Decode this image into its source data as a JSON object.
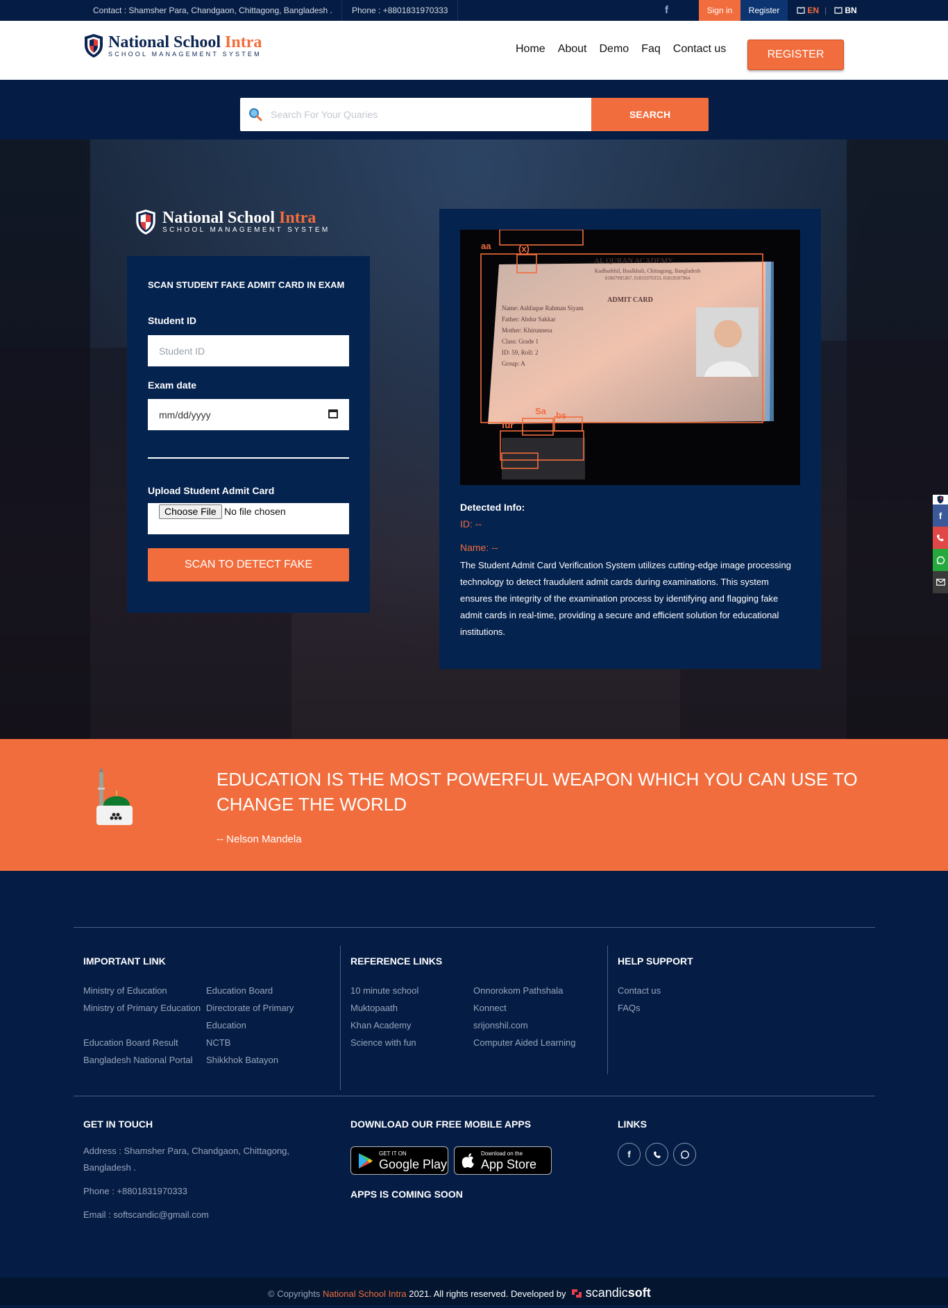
{
  "topbar": {
    "contact": "Contact : Shamsher Para, Chandgaon, Chittagong, Bangladesh .",
    "phone": "Phone : +8801831970333",
    "facebook_icon": "f",
    "signin": "Sign in",
    "register": "Register",
    "lang_en": "EN",
    "lang_separator": "|",
    "lang_bn": "BN"
  },
  "brand": {
    "name_primary": "National School",
    "name_accent": "Intra",
    "subtitle": "SCHOOL MANAGEMENT SYSTEM"
  },
  "nav": {
    "items": [
      "Home",
      "About",
      "Demo",
      "Faq",
      "Contact us"
    ],
    "register_button": "REGISTER"
  },
  "search": {
    "placeholder": "Search For Your Quaries",
    "button": "SEARCH"
  },
  "scan_form": {
    "title": "SCAN STUDENT FAKE ADMIT CARD IN EXAM",
    "student_id_label": "Student ID",
    "student_id_placeholder": "Student ID",
    "exam_date_label": "Exam date",
    "exam_date_placeholder": "mm/dd/yyyy",
    "upload_label": "Upload Student Admit Card",
    "choose_file": "Choose File",
    "no_file": "No file chosen",
    "scan_button": "SCAN TO DETECT FAKE"
  },
  "admit_card_image": {
    "academy": "AL QURAN ACADEMY",
    "address": "Kadhurkhil, Boalkhali, Chittagong, Bangladesh",
    "phones": "01867995367, 01831970333, 01819507964",
    "heading": "ADMIT CARD",
    "lines": [
      "Name: Ashfaque Rahman Siyam",
      "Father: Abdur Sakkar",
      "Mother: Khirunnesa",
      "Class: Grade 1",
      "ID: 59, Roll: 2",
      "Group: A"
    ],
    "detect_labels": [
      "aa",
      "(x)",
      "Sa",
      "bs",
      "fur"
    ]
  },
  "detected": {
    "title": "Detected Info:",
    "id": "ID: --",
    "name": "Name: --",
    "description": "The Student Admit Card Verification System utilizes cutting-edge image processing technology to detect fraudulent admit cards during examinations. This system ensures the integrity of the examination process by identifying and flagging fake admit cards in real-time, providing a secure and efficient solution for educational institutions."
  },
  "quote": {
    "text": "EDUCATION IS THE MOST POWERFUL WEAPON WHICH YOU CAN USE TO CHANGE THE WORLD",
    "author": "-- Nelson Mandela"
  },
  "footer": {
    "important_title": "IMPORTANT LINK",
    "important_col1": [
      "Ministry of Education",
      "Ministry of Primary Education",
      "",
      "Education Board Result",
      "Bangladesh National Portal"
    ],
    "important_col2": [
      "Education Board",
      "Directorate of Primary",
      "Education",
      "NCTB",
      "Shikkhok Batayon"
    ],
    "reference_title": "REFERENCE LINKS",
    "reference_col1": [
      "10 minute school",
      "Muktopaath",
      "Khan Academy",
      "Science with fun"
    ],
    "reference_col2": [
      "Onnorokom Pathshala",
      "Konnect",
      "srijonshil.com",
      "Computer Aided Learning"
    ],
    "help_title": "HELP SUPPORT",
    "help_links": [
      "Contact us",
      "FAQs"
    ],
    "touch_title": "GET IN TOUCH",
    "address": "Address : Shamsher Para, Chandgaon, Chittagong, Bangladesh .",
    "phone": "Phone : +8801831970333",
    "email": "Email : softscandic@gmail.com",
    "apps_title": "DOWNLOAD OUR FREE MOBILE APPS",
    "google_small": "GET IT ON",
    "google_big": "Google Play",
    "apple_small": "Download on the",
    "apple_big": "App Store",
    "apps_soon": "APPS IS COMING SOON",
    "links_title": "LINKS"
  },
  "copyright": {
    "prefix": "© Copyrights",
    "brand": "National School Intra",
    "suffix": "2021. All rights reserved. Developed by",
    "dev_light": "scandic",
    "dev_bold": "soft"
  },
  "colors": {
    "navy": "#051d45",
    "orange": "#f26d3d",
    "facebook": "#3b5998",
    "phone": "#e04848",
    "whatsapp": "#25a83c",
    "mail": "#3a3a3a"
  }
}
